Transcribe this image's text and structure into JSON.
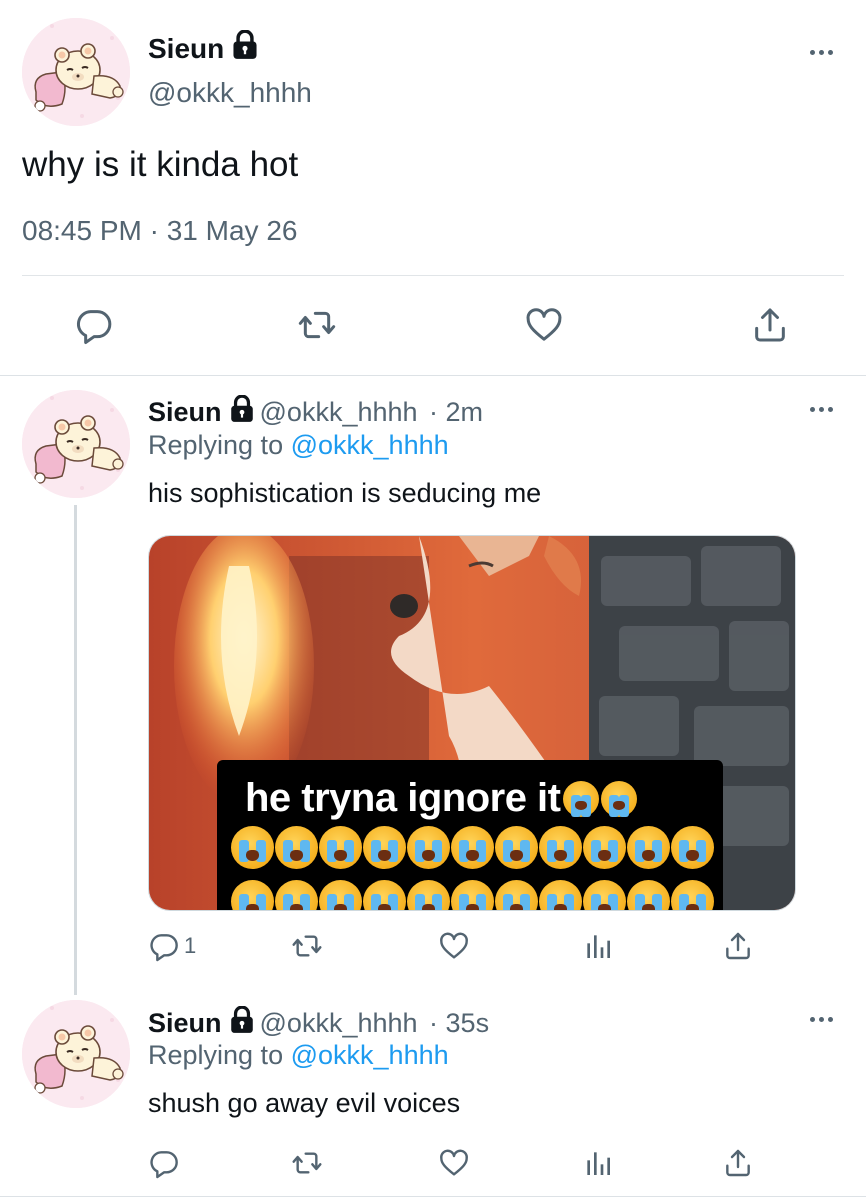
{
  "main_tweet": {
    "name": "Sieun",
    "handle": "@okkk_hhhh",
    "text": "why is it kinda hot",
    "timestamp": "08:45 PM · 31 May 26",
    "actions": [
      "reply-icon",
      "retweet-icon",
      "like-icon",
      "share-icon"
    ]
  },
  "replies": [
    {
      "name": "Sieun",
      "handle": "@okkk_hhhh",
      "time": "· 2m",
      "replying_prefix": "Replying to",
      "replying_to": "@okkk_hhhh",
      "text": "his sophistication is seducing me",
      "media": {
        "caption": "he tryna ignore it",
        "emoji": "loudly-crying-face"
      },
      "reply_count": "1"
    },
    {
      "name": "Sieun",
      "handle": "@okkk_hhhh",
      "time": "· 35s",
      "replying_prefix": "Replying to",
      "replying_to": "@okkk_hhhh",
      "text": "shush go away evil voices"
    }
  ],
  "colors": {
    "text": "#0f1419",
    "secondary": "#536471",
    "link": "#1d9bf0",
    "divider": "#e1e5e8"
  }
}
